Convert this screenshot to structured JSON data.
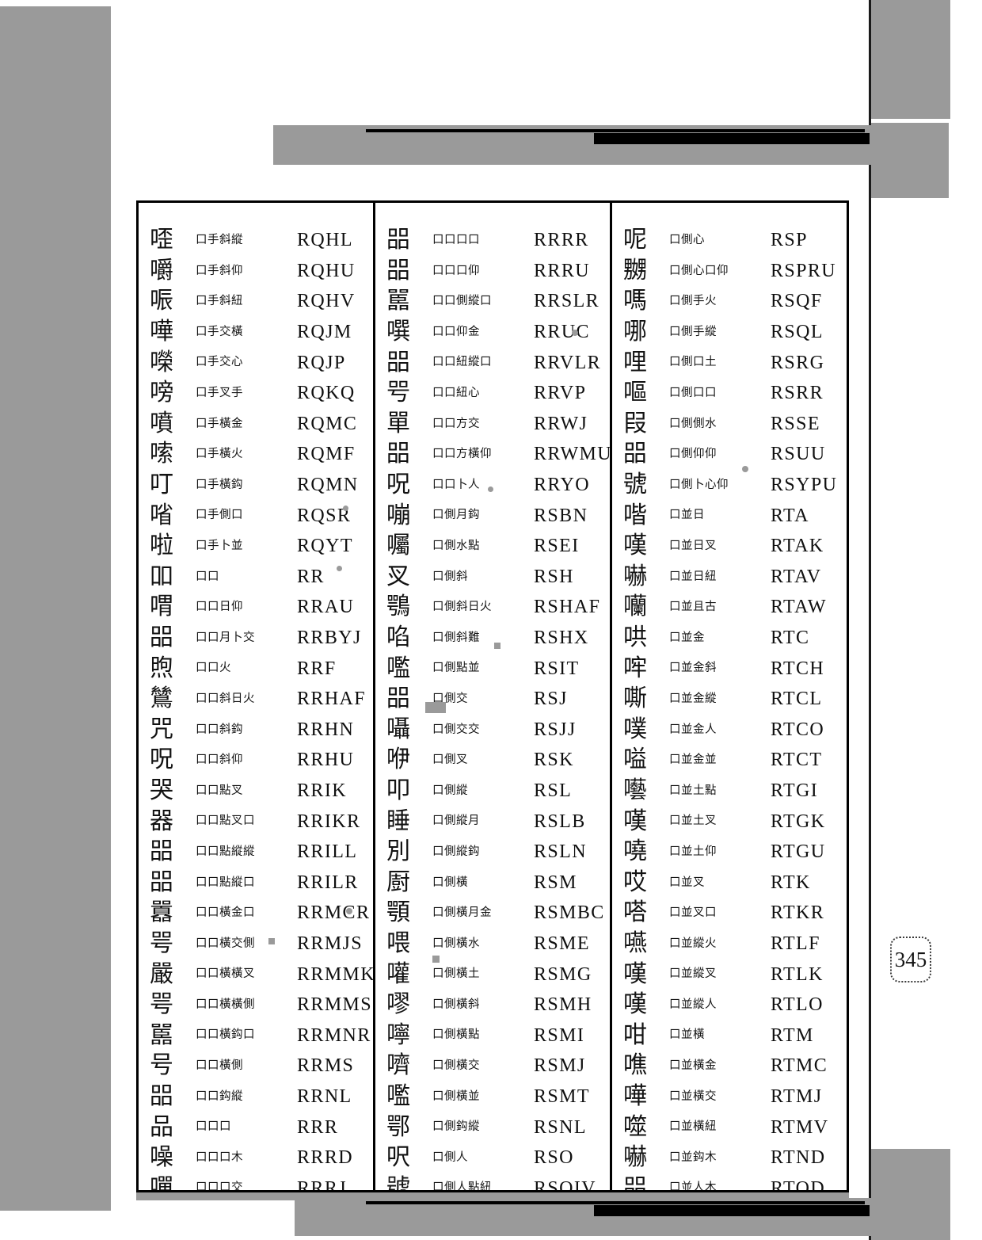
{
  "document": {
    "type": "cangjie-code-dictionary-page",
    "page_number": "345"
  },
  "columns": [
    {
      "id": "column-1",
      "rows": [
        {
          "glyph": "㗏",
          "decomposition": "口手斜縱",
          "code": "RQHL"
        },
        {
          "glyph": "嚼",
          "decomposition": "口手斜仰",
          "code": "RQHU"
        },
        {
          "glyph": "㖘",
          "decomposition": "口手斜紐",
          "code": "RQHV"
        },
        {
          "glyph": "嘩",
          "decomposition": "口手交橫",
          "code": "RQJM"
        },
        {
          "glyph": "㘇",
          "decomposition": "口手交心",
          "code": "RQJP"
        },
        {
          "glyph": "嗙",
          "decomposition": "口手叉手",
          "code": "RQKQ"
        },
        {
          "glyph": "噴",
          "decomposition": "口手橫金",
          "code": "RQMC"
        },
        {
          "glyph": "嗦",
          "decomposition": "口手橫火",
          "code": "RQMF"
        },
        {
          "glyph": "叮",
          "decomposition": "口手橫鈎",
          "code": "RQMN"
        },
        {
          "glyph": "㗂",
          "decomposition": "口手側口",
          "code": "RQSR"
        },
        {
          "glyph": "啦",
          "decomposition": "口手卜並",
          "code": "RQYT"
        },
        {
          "glyph": "吅",
          "decomposition": "口口",
          "code": "RR"
        },
        {
          "glyph": "喟",
          "decomposition": "口口日仰",
          "code": "RRAU"
        },
        {
          "glyph": "㗊",
          "decomposition": "口口月卜交",
          "code": "RRBYJ"
        },
        {
          "glyph": "煦",
          "decomposition": "口口火",
          "code": "RRF"
        },
        {
          "glyph": "鷥",
          "decomposition": "口口斜日火",
          "code": "RRHAF"
        },
        {
          "glyph": "咒",
          "decomposition": "口口斜鈎",
          "code": "RRHN"
        },
        {
          "glyph": "呪",
          "decomposition": "口口斜仰",
          "code": "RRHU"
        },
        {
          "glyph": "哭",
          "decomposition": "口口點叉",
          "code": "RRIK"
        },
        {
          "glyph": "器",
          "decomposition": "口口點叉口",
          "code": "RRIKR"
        },
        {
          "glyph": "㗊",
          "decomposition": "口口點縱縱",
          "code": "RRILL"
        },
        {
          "glyph": "㗊",
          "decomposition": "口口點縱口",
          "code": "RRILR"
        },
        {
          "glyph": "囂",
          "decomposition": "口口橫金口",
          "code": "RRMCR"
        },
        {
          "glyph": "咢",
          "decomposition": "口口橫交側",
          "code": "RRMJS"
        },
        {
          "glyph": "嚴",
          "decomposition": "口口橫橫叉",
          "code": "RRMMK"
        },
        {
          "glyph": "咢",
          "decomposition": "口口橫橫側",
          "code": "RRMMS"
        },
        {
          "glyph": "嚚",
          "decomposition": "口口橫鈎口",
          "code": "RRMNR"
        },
        {
          "glyph": "号",
          "decomposition": "口口橫側",
          "code": "RRMS"
        },
        {
          "glyph": "㗊",
          "decomposition": "口口鈎縱",
          "code": "RRNL"
        },
        {
          "glyph": "品",
          "decomposition": "口口口",
          "code": "RRR"
        },
        {
          "glyph": "噪",
          "decomposition": "口口口木",
          "code": "RRRD"
        },
        {
          "glyph": "嘽",
          "decomposition": "口口口交",
          "code": "RRRJ"
        }
      ]
    },
    {
      "id": "column-2",
      "rows": [
        {
          "glyph": "㗊",
          "decomposition": "口口口口",
          "code": "RRRR"
        },
        {
          "glyph": "㗊",
          "decomposition": "口口口仰",
          "code": "RRRU"
        },
        {
          "glyph": "嚚",
          "decomposition": "口口側縱口",
          "code": "RRSLR"
        },
        {
          "glyph": "噀",
          "decomposition": "口口仰金",
          "code": "RRUC"
        },
        {
          "glyph": "㗊",
          "decomposition": "口口紐縱口",
          "code": "RRVLR"
        },
        {
          "glyph": "㕺",
          "decomposition": "口口紐心",
          "code": "RRVP"
        },
        {
          "glyph": "單",
          "decomposition": "口口方交",
          "code": "RRWJ"
        },
        {
          "glyph": "㗊",
          "decomposition": "口口方橫仰",
          "code": "RRWMU"
        },
        {
          "glyph": "呪",
          "decomposition": "口口卜人",
          "code": "RRYO"
        },
        {
          "glyph": "嘣",
          "decomposition": "口側月鈎",
          "code": "RSBN"
        },
        {
          "glyph": "囑",
          "decomposition": "口側水點",
          "code": "RSEI"
        },
        {
          "glyph": "㕚",
          "decomposition": "口側斜",
          "code": "RSH"
        },
        {
          "glyph": "鶚",
          "decomposition": "口側斜日火",
          "code": "RSHAF"
        },
        {
          "glyph": "啗",
          "decomposition": "口側斜難",
          "code": "RSHX"
        },
        {
          "glyph": "嚂",
          "decomposition": "口側點並",
          "code": "RSIT"
        },
        {
          "glyph": "㗊",
          "decomposition": "口側交",
          "code": "RSJ"
        },
        {
          "glyph": "囁",
          "decomposition": "口側交交",
          "code": "RSJJ"
        },
        {
          "glyph": "咿",
          "decomposition": "口側叉",
          "code": "RSK"
        },
        {
          "glyph": "叩",
          "decomposition": "口側縱",
          "code": "RSL"
        },
        {
          "glyph": "睡",
          "decomposition": "口側縱月",
          "code": "RSLB"
        },
        {
          "glyph": "別",
          "decomposition": "口側縱鈎",
          "code": "RSLN"
        },
        {
          "glyph": "㕑",
          "decomposition": "口側橫",
          "code": "RSM"
        },
        {
          "glyph": "顎",
          "decomposition": "口側橫月金",
          "code": "RSMBC"
        },
        {
          "glyph": "喂",
          "decomposition": "口側橫水",
          "code": "RSME"
        },
        {
          "glyph": "嚾",
          "decomposition": "口側橫土",
          "code": "RSMG"
        },
        {
          "glyph": "嘐",
          "decomposition": "口側橫斜",
          "code": "RSMH"
        },
        {
          "glyph": "嚀",
          "decomposition": "口側橫點",
          "code": "RSMI"
        },
        {
          "glyph": "嚌",
          "decomposition": "口側橫交",
          "code": "RSMJ"
        },
        {
          "glyph": "嚂",
          "decomposition": "口側橫並",
          "code": "RSMT"
        },
        {
          "glyph": "鄂",
          "decomposition": "口側鈎縱",
          "code": "RSNL"
        },
        {
          "glyph": "呎",
          "decomposition": "口側人",
          "code": "RSO"
        },
        {
          "glyph": "號",
          "decomposition": "口側人點紐",
          "code": "RSOIV"
        }
      ]
    },
    {
      "id": "column-3",
      "rows": [
        {
          "glyph": "呢",
          "decomposition": "口側心",
          "code": "RSP"
        },
        {
          "glyph": "嬲",
          "decomposition": "口側心口仰",
          "code": "RSPRU"
        },
        {
          "glyph": "嗎",
          "decomposition": "口側手火",
          "code": "RSQF"
        },
        {
          "glyph": "哪",
          "decomposition": "口側手縱",
          "code": "RSQL"
        },
        {
          "glyph": "哩",
          "decomposition": "口側口土",
          "code": "RSRG"
        },
        {
          "glyph": "嘔",
          "decomposition": "口側口口",
          "code": "RSRR"
        },
        {
          "glyph": "叚",
          "decomposition": "口側側水",
          "code": "RSSE"
        },
        {
          "glyph": "㗊",
          "decomposition": "口側仰仰",
          "code": "RSUU"
        },
        {
          "glyph": "號",
          "decomposition": "口側卜心仰",
          "code": "RSYPU"
        },
        {
          "glyph": "喈",
          "decomposition": "口並日",
          "code": "RTA"
        },
        {
          "glyph": "嘆",
          "decomposition": "口並日叉",
          "code": "RTAK"
        },
        {
          "glyph": "嚇",
          "decomposition": "口並日紐",
          "code": "RTAV"
        },
        {
          "glyph": "囒",
          "decomposition": "口並且古",
          "code": "RTAW"
        },
        {
          "glyph": "哄",
          "decomposition": "口並金",
          "code": "RTC"
        },
        {
          "glyph": "哰",
          "decomposition": "口並金斜",
          "code": "RTCH"
        },
        {
          "glyph": "嘶",
          "decomposition": "口並金縱",
          "code": "RTCL"
        },
        {
          "glyph": "噗",
          "decomposition": "口並金人",
          "code": "RTCO"
        },
        {
          "glyph": "嗌",
          "decomposition": "口並金並",
          "code": "RTCT"
        },
        {
          "glyph": "囈",
          "decomposition": "口並土點",
          "code": "RTGI"
        },
        {
          "glyph": "嘆",
          "decomposition": "口並土叉",
          "code": "RTGK"
        },
        {
          "glyph": "嘵",
          "decomposition": "口並土仰",
          "code": "RTGU"
        },
        {
          "glyph": "哎",
          "decomposition": "口並叉",
          "code": "RTK"
        },
        {
          "glyph": "嗒",
          "decomposition": "口並叉口",
          "code": "RTKR"
        },
        {
          "glyph": "嚥",
          "decomposition": "口並縱火",
          "code": "RTLF"
        },
        {
          "glyph": "嘆",
          "decomposition": "口並縱叉",
          "code": "RTLK"
        },
        {
          "glyph": "嘆",
          "decomposition": "口並縱人",
          "code": "RTLO"
        },
        {
          "glyph": "咁",
          "decomposition": "口並橫",
          "code": "RTM"
        },
        {
          "glyph": "噍",
          "decomposition": "口並橫金",
          "code": "RTMC"
        },
        {
          "glyph": "嘩",
          "decomposition": "口並橫交",
          "code": "RTMJ"
        },
        {
          "glyph": "噬",
          "decomposition": "口並橫紐",
          "code": "RTMV"
        },
        {
          "glyph": "嚇",
          "decomposition": "口並鈎木",
          "code": "RTND"
        },
        {
          "glyph": "㗊",
          "decomposition": "口並人木",
          "code": "RTOD"
        }
      ]
    }
  ]
}
